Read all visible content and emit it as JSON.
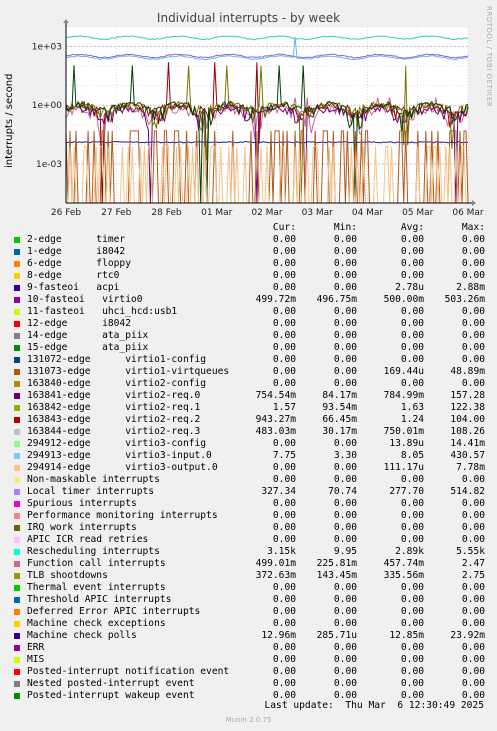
{
  "title": "Individual interrupts - by week",
  "watermark": "RRDTOOL / TOBI OETIKER",
  "ylabel": "interrupts / second",
  "columns": [
    "Cur:",
    "Min:",
    "Avg:",
    "Max:"
  ],
  "last_update": "Last update:  Thu Mar  6 12:30:49 2025",
  "version": "Munin 2.0.75",
  "chart_data": {
    "type": "line",
    "title": "Individual interrupts - by week",
    "ylabel": "interrupts / second",
    "yscale": "log",
    "ylim": [
      1e-05,
      10000
    ],
    "y_ticks": [
      {
        "value": 1000,
        "label": "1e+03"
      },
      {
        "value": 1,
        "label": "1e+00"
      },
      {
        "value": 0.001,
        "label": "1e-03"
      }
    ],
    "x_ticks": [
      "26 Feb",
      "27 Feb",
      "28 Feb",
      "01 Mar",
      "02 Mar",
      "03 Mar",
      "04 Mar",
      "05 Mar",
      "06 Mar"
    ],
    "grid": true,
    "series": [
      {
        "name": "Rescheduling interrupts",
        "color": "#24d9a6",
        "avg": 2890,
        "min": 9.95,
        "max": 5550
      },
      {
        "name": "TLB shootdowns",
        "color": "#8866dd",
        "avg": 335.56,
        "min": 143.45,
        "max": 2.75
      },
      {
        "name": "Local timer interrupts",
        "color": "#6fb3e5",
        "avg": 277.7,
        "min": 70.74,
        "max": 514.82
      },
      {
        "name": "Function call interrupts",
        "color": "#cc6699",
        "avg": 0.45774,
        "min": 0.22581,
        "max": 2.47
      },
      {
        "name": "virtio2-req.0",
        "color": "#990000",
        "avg": 0.78499,
        "min": 0.08417,
        "max": 157.28
      },
      {
        "name": "virtio0",
        "color": "#770077",
        "avg": 0.5,
        "min": 0.49675,
        "max": 0.50326
      },
      {
        "name": "virtio2-req.2",
        "color": "#777700",
        "avg": 0.75001,
        "min": 0.06645,
        "max": 104
      },
      {
        "name": "virtio2-req.3",
        "color": "#004400",
        "avg": 0.75001,
        "min": 0.03017,
        "max": 108.26
      },
      {
        "name": "Machine check polls",
        "color": "#1a1a9a",
        "avg": 0.01285,
        "min": 0.00028571,
        "max": 0.02392
      },
      {
        "name": "virtio1-virtqueues",
        "color": "#b0581e",
        "avg": 0.00016944,
        "min": 0,
        "max": 0.04889
      },
      {
        "name": "virtio3-output.0",
        "color": "#f5c48a",
        "avg": 0.00011117,
        "min": 0,
        "max": 0.00778
      }
    ]
  },
  "legend": [
    {
      "label": "2-edge      timer",
      "color": "#00cc00",
      "cur": "0.00",
      "min": "0.00",
      "avg": "0.00",
      "max": "0.00"
    },
    {
      "label": "1-edge      i8042",
      "color": "#0066b3",
      "cur": "0.00",
      "min": "0.00",
      "avg": "0.00",
      "max": "0.00"
    },
    {
      "label": "6-edge      floppy",
      "color": "#ff8000",
      "cur": "0.00",
      "min": "0.00",
      "avg": "0.00",
      "max": "0.00"
    },
    {
      "label": "8-edge      rtc0",
      "color": "#ffcc00",
      "cur": "0.00",
      "min": "0.00",
      "avg": "0.00",
      "max": "0.00"
    },
    {
      "label": "9-fasteoi   acpi",
      "color": "#330099",
      "cur": "0.00",
      "min": "0.00",
      "avg": "2.78u",
      "max": "2.88m"
    },
    {
      "label": "10-fasteoi   virtio0",
      "color": "#990099",
      "cur": "499.72m",
      "min": "496.75m",
      "avg": "500.00m",
      "max": "503.26m"
    },
    {
      "label": "11-fasteoi   uhci_hcd:usb1",
      "color": "#ccff00",
      "cur": "0.00",
      "min": "0.00",
      "avg": "0.00",
      "max": "0.00"
    },
    {
      "label": "12-edge      i8042",
      "color": "#ff0000",
      "cur": "0.00",
      "min": "0.00",
      "avg": "0.00",
      "max": "0.00"
    },
    {
      "label": "14-edge      ata_piix",
      "color": "#808080",
      "cur": "0.00",
      "min": "0.00",
      "avg": "0.00",
      "max": "0.00"
    },
    {
      "label": "15-edge      ata_piix",
      "color": "#008f00",
      "cur": "0.00",
      "min": "0.00",
      "avg": "0.00",
      "max": "0.00"
    },
    {
      "label": "131072-edge      virtio1-config",
      "color": "#00487d",
      "cur": "0.00",
      "min": "0.00",
      "avg": "0.00",
      "max": "0.00"
    },
    {
      "label": "131073-edge      virtio1-virtqueues",
      "color": "#b35a00",
      "cur": "0.00",
      "min": "0.00",
      "avg": "169.44u",
      "max": "48.89m"
    },
    {
      "label": "163840-edge      virtio2-config",
      "color": "#b38f00",
      "cur": "0.00",
      "min": "0.00",
      "avg": "0.00",
      "max": "0.00"
    },
    {
      "label": "163841-edge      virtio2-req.0",
      "color": "#6b006b",
      "cur": "754.54m",
      "min": "84.17m",
      "avg": "784.99m",
      "max": "157.28"
    },
    {
      "label": "163842-edge      virtio2-req.1",
      "color": "#8fb300",
      "cur": "1.57",
      "min": "93.54m",
      "avg": "1.63",
      "max": "122.38"
    },
    {
      "label": "163843-edge      virtio2-req.2",
      "color": "#b30000",
      "cur": "943.27m",
      "min": "66.45m",
      "avg": "1.24",
      "max": "104.00"
    },
    {
      "label": "163844-edge      virtio2-req.3",
      "color": "#bebebe",
      "cur": "483.03m",
      "min": "30.17m",
      "avg": "750.01m",
      "max": "108.26"
    },
    {
      "label": "294912-edge      virtio3-config",
      "color": "#80ff80",
      "cur": "0.00",
      "min": "0.00",
      "avg": "13.89u",
      "max": "14.41m"
    },
    {
      "label": "294913-edge      virtio3-input.0",
      "color": "#80c9ff",
      "cur": "7.75",
      "min": "3.30",
      "avg": "8.05",
      "max": "430.57"
    },
    {
      "label": "294914-edge      virtio3-output.0",
      "color": "#ffc080",
      "cur": "0.00",
      "min": "0.00",
      "avg": "111.17u",
      "max": "7.78m"
    },
    {
      "label": "Non-maskable interrupts",
      "color": "#ffe680",
      "cur": "0.00",
      "min": "0.00",
      "avg": "0.00",
      "max": "0.00"
    },
    {
      "label": "Local timer interrupts",
      "color": "#aa80ff",
      "cur": "327.34",
      "min": "70.74",
      "avg": "277.70",
      "max": "514.82"
    },
    {
      "label": "Spurious interrupts",
      "color": "#ee00cc",
      "cur": "0.00",
      "min": "0.00",
      "avg": "0.00",
      "max": "0.00"
    },
    {
      "label": "Performance monitoring interrupts",
      "color": "#ff8080",
      "cur": "0.00",
      "min": "0.00",
      "avg": "0.00",
      "max": "0.00"
    },
    {
      "label": "IRQ work interrupts",
      "color": "#666600",
      "cur": "0.00",
      "min": "0.00",
      "avg": "0.00",
      "max": "0.00"
    },
    {
      "label": "APIC ICR read retries",
      "color": "#ffbfff",
      "cur": "0.00",
      "min": "0.00",
      "avg": "0.00",
      "max": "0.00"
    },
    {
      "label": "Rescheduling interrupts",
      "color": "#00ffcc",
      "cur": "3.15k",
      "min": "9.95",
      "avg": "2.89k",
      "max": "5.55k"
    },
    {
      "label": "Function call interrupts",
      "color": "#cc6699",
      "cur": "499.01m",
      "min": "225.81m",
      "avg": "457.74m",
      "max": "2.47"
    },
    {
      "label": "TLB shootdowns",
      "color": "#999900",
      "cur": "372.63m",
      "min": "143.45m",
      "avg": "335.56m",
      "max": "2.75"
    },
    {
      "label": "Thermal event interrupts",
      "color": "#00cc00",
      "cur": "0.00",
      "min": "0.00",
      "avg": "0.00",
      "max": "0.00"
    },
    {
      "label": "Threshold APIC interrupts",
      "color": "#0066b3",
      "cur": "0.00",
      "min": "0.00",
      "avg": "0.00",
      "max": "0.00"
    },
    {
      "label": "Deferred Error APIC interrupts",
      "color": "#ff8000",
      "cur": "0.00",
      "min": "0.00",
      "avg": "0.00",
      "max": "0.00"
    },
    {
      "label": "Machine check exceptions",
      "color": "#ffcc00",
      "cur": "0.00",
      "min": "0.00",
      "avg": "0.00",
      "max": "0.00"
    },
    {
      "label": "Machine check polls",
      "color": "#330099",
      "cur": "12.96m",
      "min": "285.71u",
      "avg": "12.85m",
      "max": "23.92m"
    },
    {
      "label": "ERR",
      "color": "#990099",
      "cur": "0.00",
      "min": "0.00",
      "avg": "0.00",
      "max": "0.00"
    },
    {
      "label": "MIS",
      "color": "#ccff00",
      "cur": "0.00",
      "min": "0.00",
      "avg": "0.00",
      "max": "0.00"
    },
    {
      "label": "Posted-interrupt notification event",
      "color": "#ff0000",
      "cur": "0.00",
      "min": "0.00",
      "avg": "0.00",
      "max": "0.00"
    },
    {
      "label": "Nested posted-interrupt event",
      "color": "#808080",
      "cur": "0.00",
      "min": "0.00",
      "avg": "0.00",
      "max": "0.00"
    },
    {
      "label": "Posted-interrupt wakeup event",
      "color": "#008f00",
      "cur": "0.00",
      "min": "0.00",
      "avg": "0.00",
      "max": "0.00"
    }
  ]
}
